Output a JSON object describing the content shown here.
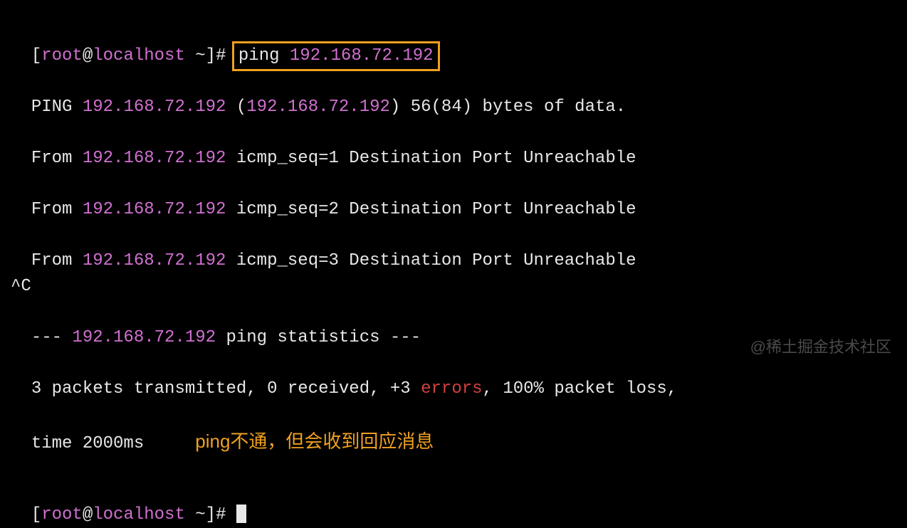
{
  "prompt1": {
    "bracket_open": "[",
    "user": "root",
    "at": "@",
    "host": "localhost",
    "path": " ~",
    "bracket_close": "]# ",
    "cmd_name": "ping ",
    "cmd_arg": "192.168.72.192"
  },
  "ping_header": {
    "prefix": "PING ",
    "ip1": "192.168.72.192",
    "paren_open": " (",
    "ip2": "192.168.72.192",
    "paren_close": ") 56(84) bytes of data."
  },
  "replies": [
    {
      "from": "From ",
      "ip": "192.168.72.192",
      "rest": " icmp_seq=1 Destination Port Unreachable"
    },
    {
      "from": "From ",
      "ip": "192.168.72.192",
      "rest": " icmp_seq=2 Destination Port Unreachable"
    },
    {
      "from": "From ",
      "ip": "192.168.72.192",
      "rest": " icmp_seq=3 Destination Port Unreachable"
    }
  ],
  "interrupt": "^C",
  "stats_header": {
    "dashes1": "--- ",
    "ip": "192.168.72.192",
    "rest": " ping statistics ---"
  },
  "stats_line": {
    "part1": "3 packets transmitted, 0 received, +3 ",
    "errors": "errors",
    "part2": ", 100% packet loss,"
  },
  "time_line": "time 2000ms",
  "annotation": "ping不通，但会收到回应消息",
  "prompt2": {
    "bracket_open": "[",
    "user": "root",
    "at": "@",
    "host": "localhost",
    "path": " ~",
    "bracket_close": "]# "
  },
  "watermark": "@稀土掘金技术社区"
}
